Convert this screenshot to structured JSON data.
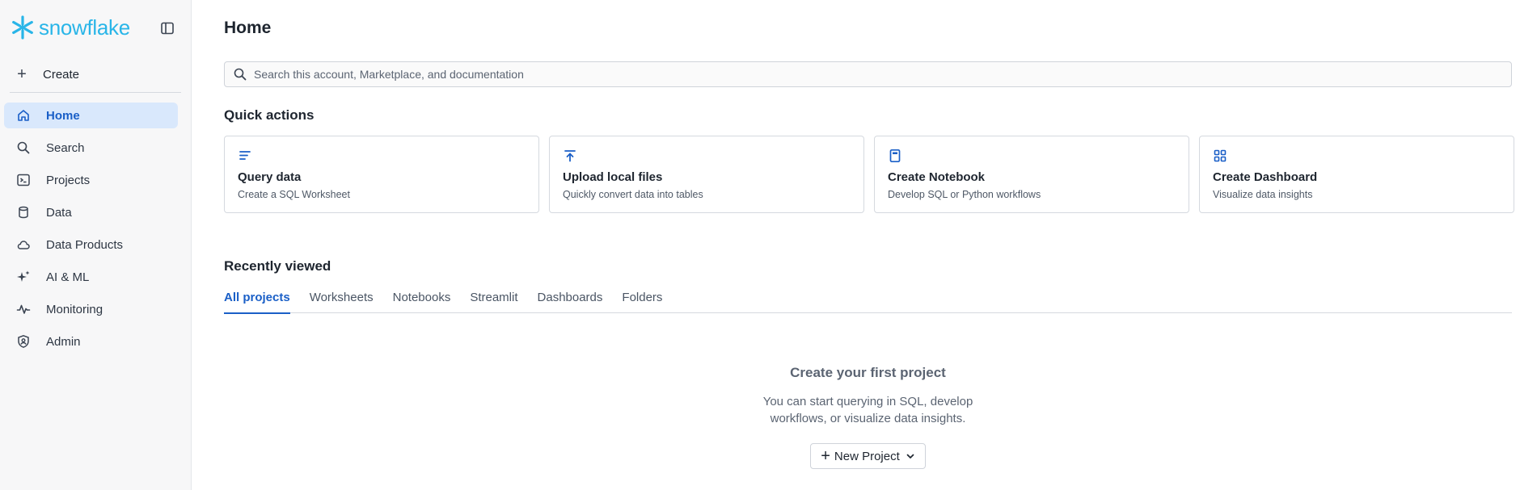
{
  "sidebar": {
    "brand": "snowflake",
    "create_label": "Create",
    "nav": [
      {
        "label": "Home",
        "icon": "home-icon",
        "active": true
      },
      {
        "label": "Search",
        "icon": "search-icon"
      },
      {
        "label": "Projects",
        "icon": "terminal-icon"
      },
      {
        "label": "Data",
        "icon": "database-icon"
      },
      {
        "label": "Data Products",
        "icon": "cloud-icon"
      },
      {
        "label": "AI & ML",
        "icon": "sparkle-icon"
      },
      {
        "label": "Monitoring",
        "icon": "activity-icon"
      },
      {
        "label": "Admin",
        "icon": "shield-user-icon"
      }
    ]
  },
  "main": {
    "title": "Home",
    "search": {
      "placeholder": "Search this account, Marketplace, and documentation"
    },
    "quick_actions": {
      "title": "Quick actions",
      "cards": [
        {
          "title": "Query data",
          "desc": "Create a SQL Worksheet",
          "icon": "lines-icon"
        },
        {
          "title": "Upload local files",
          "desc": "Quickly convert data into tables",
          "icon": "upload-icon"
        },
        {
          "title": "Create Notebook",
          "desc": "Develop SQL or Python workflows",
          "icon": "notebook-icon"
        },
        {
          "title": "Create Dashboard",
          "desc": "Visualize data insights",
          "icon": "grid-icon"
        }
      ]
    },
    "recently_viewed": {
      "title": "Recently viewed",
      "tabs": [
        "All projects",
        "Worksheets",
        "Notebooks",
        "Streamlit",
        "Dashboards",
        "Folders"
      ],
      "active_tab": 0
    },
    "empty_state": {
      "title": "Create your first project",
      "desc": "You can start querying in SQL, develop workflows, or visualize data insights.",
      "button_label": "New Project"
    }
  },
  "colors": {
    "accent": "#1a5fc7",
    "brand": "#29b5e8",
    "active_bg": "#d9e8fc"
  }
}
